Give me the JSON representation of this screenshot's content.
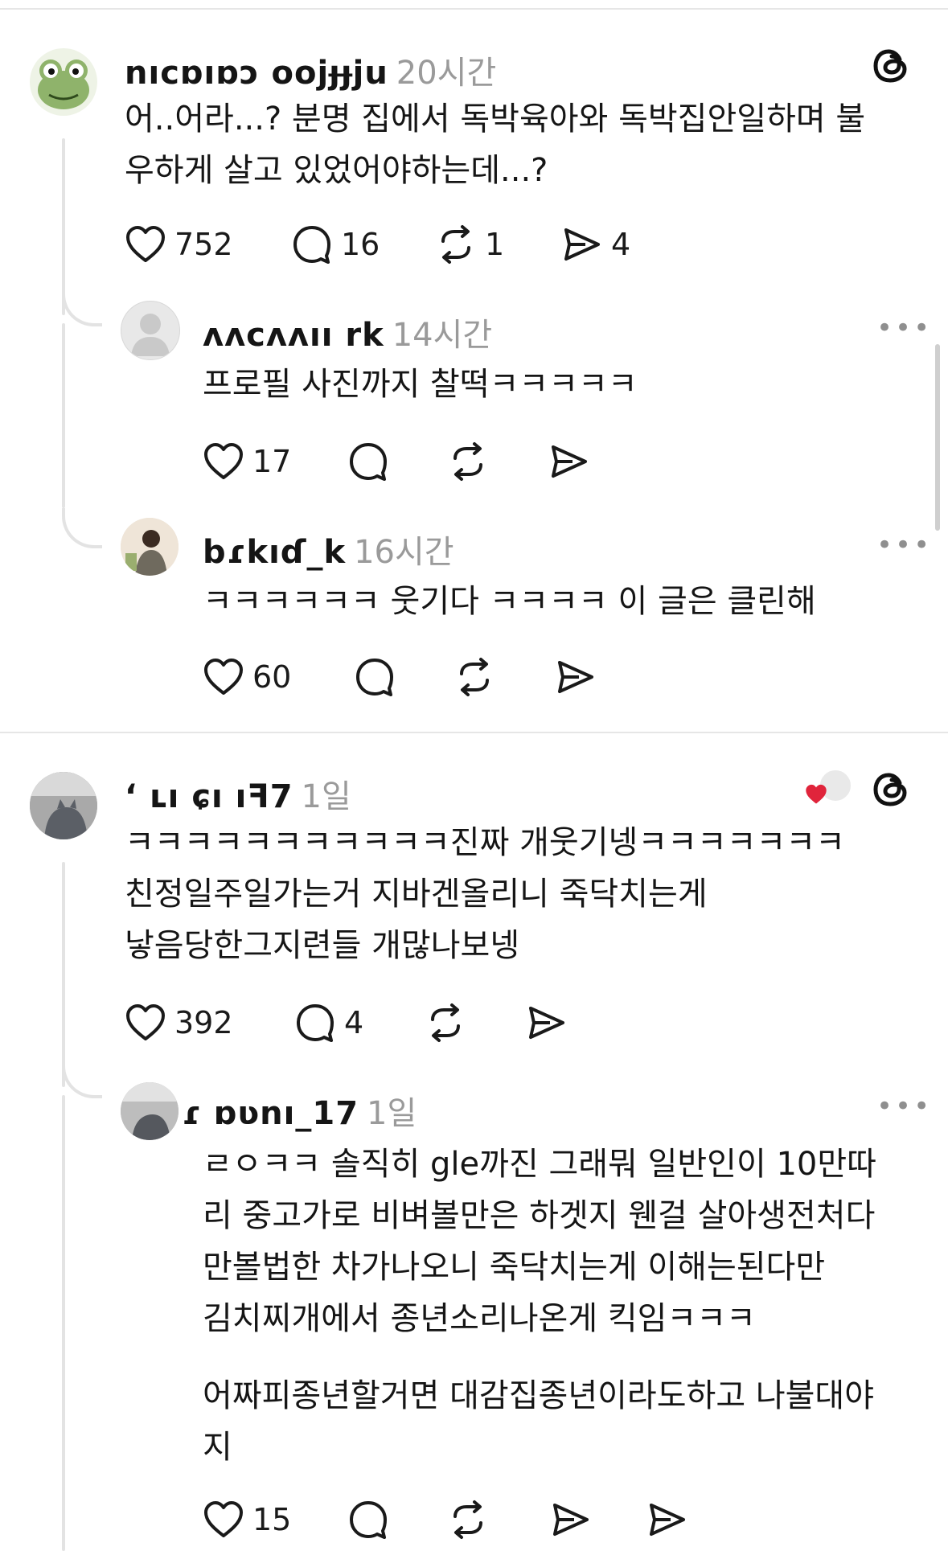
{
  "posts": [
    {
      "username": "nıcɒıɒɔ oojɟɟju",
      "time": "20시간",
      "lines": [
        "어..어라...? 분명 집에서 독박육아와 독박집안일하며 불",
        "우하게 살고 있었어야하는데...?"
      ],
      "likes": "752",
      "replies": "16",
      "reposts": "1",
      "shares": "4",
      "avatar_icon": "frog-avatar-icon"
    },
    {
      "username": "ʻ ʟı ɕı ıꟻ7",
      "time": "1일",
      "lines": [
        "ㅋㅋㅋㅋㅋㅋㅋㅋㅋㅋㅋ진짜 개웃기넹ㅋㅋㅋㅋㅋㅋㅋ",
        "친정일주일가는거 지바겐올리니 죽닥치는게",
        "낳음당한그지련들 개많나보넹"
      ],
      "likes": "392",
      "replies": "4",
      "avatar_icon": "cat-photo-avatar-icon"
    }
  ],
  "replies": [
    {
      "username": "ʌʌcʌʌıı rk",
      "time": "14시간",
      "lines": [
        "프로필 사진까지 찰떡ㅋㅋㅋㅋㅋ"
      ],
      "likes": "17"
    },
    {
      "username": "bɾkıɗ_k",
      "time": "16시간",
      "lines": [
        "ㅋㅋㅋㅋㅋㅋ 웃기다 ㅋㅋㅋㅋ 이 글은 클린해"
      ],
      "likes": "60"
    },
    {
      "username": "ɾ ɒʋnı_17",
      "time": "1일",
      "lines": [
        "ㄹㅇㅋㅋ 솔직히 gle까진 그래뭐 일반인이 10만따",
        "리 중고가로 비벼볼만은 하겟지 웬걸 살아생전처다",
        "만볼법한 차가나오니 죽닥치는게 이해는된다만",
        "김치찌개에서 종년소리나온게 킥임ㅋㅋㅋ"
      ],
      "lines2": [
        "어짜피종년할거면 대감집종년이라도하고 나불대야",
        "지"
      ],
      "likes": "15"
    }
  ],
  "colors": {
    "accent_like": "#e0243b",
    "line": "#e3e3e3",
    "muted": "#9a9a9a"
  }
}
